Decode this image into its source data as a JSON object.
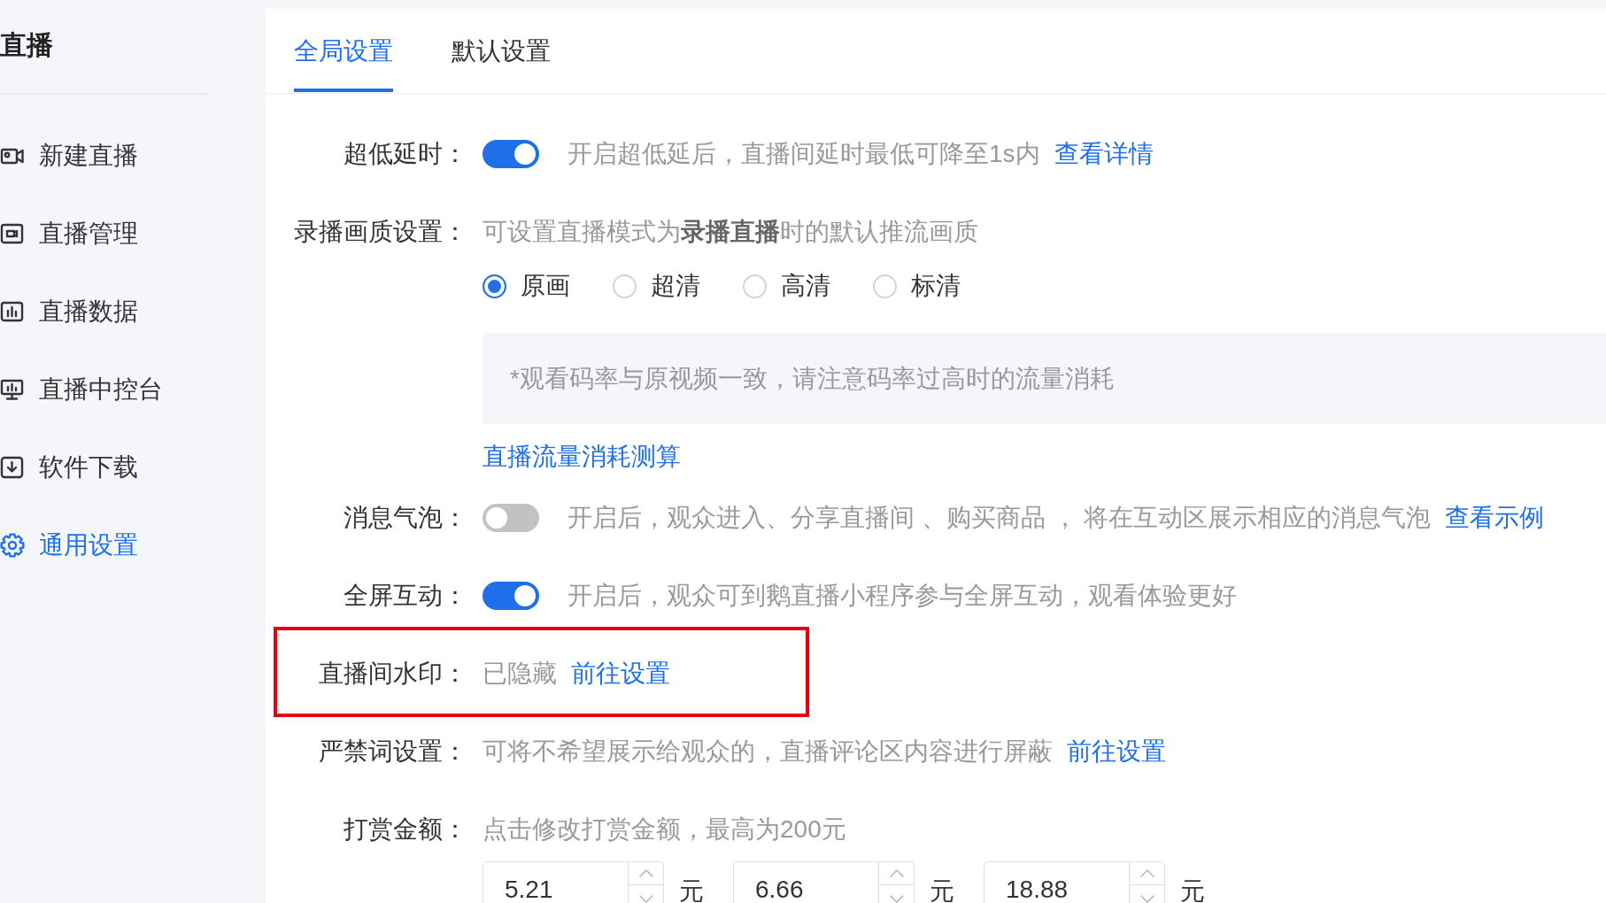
{
  "sidebar": {
    "title": "直播",
    "items": [
      {
        "label": "新建直播",
        "selected": false
      },
      {
        "label": "直播管理",
        "selected": false
      },
      {
        "label": "直播数据",
        "selected": false
      },
      {
        "label": "直播中控台",
        "selected": false
      },
      {
        "label": "软件下载",
        "selected": false
      },
      {
        "label": "通用设置",
        "selected": true
      }
    ]
  },
  "tabs": [
    {
      "label": "全局设置",
      "selected": true
    },
    {
      "label": "默认设置",
      "selected": false
    }
  ],
  "settings": [
    {
      "kind": "toggle",
      "label": "超低延时：",
      "on": true,
      "description": "开启超低延后，直播间延时最低可降至1s内",
      "link": "查看详情",
      "highlighted": false
    },
    {
      "kind": "radio",
      "label": "录播画质设置：",
      "description": "可设置直播模式为**录播直播**时的默认推流画质",
      "options": [
        {
          "label": "原画",
          "selected": true
        },
        {
          "label": "超清",
          "selected": false
        },
        {
          "label": "高清",
          "selected": false
        },
        {
          "label": "标清",
          "selected": false
        }
      ],
      "note": "*观看码率与原视频一致，请注意码率过高时的流量消耗",
      "link": "直播流量消耗测算",
      "highlighted": false
    },
    {
      "kind": "toggle",
      "label": "消息气泡：",
      "on": false,
      "description": "开启后，观众进入、分享直播间 、购买商品 ， 将在互动区展示相应的消息气泡",
      "link": "查看示例",
      "highlighted": false
    },
    {
      "kind": "toggle",
      "label": "全屏互动：",
      "on": true,
      "description": "开启后，观众可到鹅直播小程序参与全屏互动，观看体验更好",
      "highlighted": false
    },
    {
      "kind": "text",
      "label": "直播间水印：",
      "description": "已隐藏",
      "link": "前往设置",
      "highlighted": true
    },
    {
      "kind": "text",
      "label": "严禁词设置：",
      "description": "可将不希望展示给观众的，直播评论区内容进行屏蔽",
      "link": "前往设置",
      "highlighted": false
    },
    {
      "kind": "amounts",
      "label": "打赏金额：",
      "description": "点击修改打赏金额，最高为200元",
      "amounts": [
        {
          "value": "5.21",
          "unit": "元"
        },
        {
          "value": "6.66",
          "unit": "元"
        },
        {
          "value": "18.88",
          "unit": "元"
        }
      ],
      "highlighted": false
    }
  ]
}
